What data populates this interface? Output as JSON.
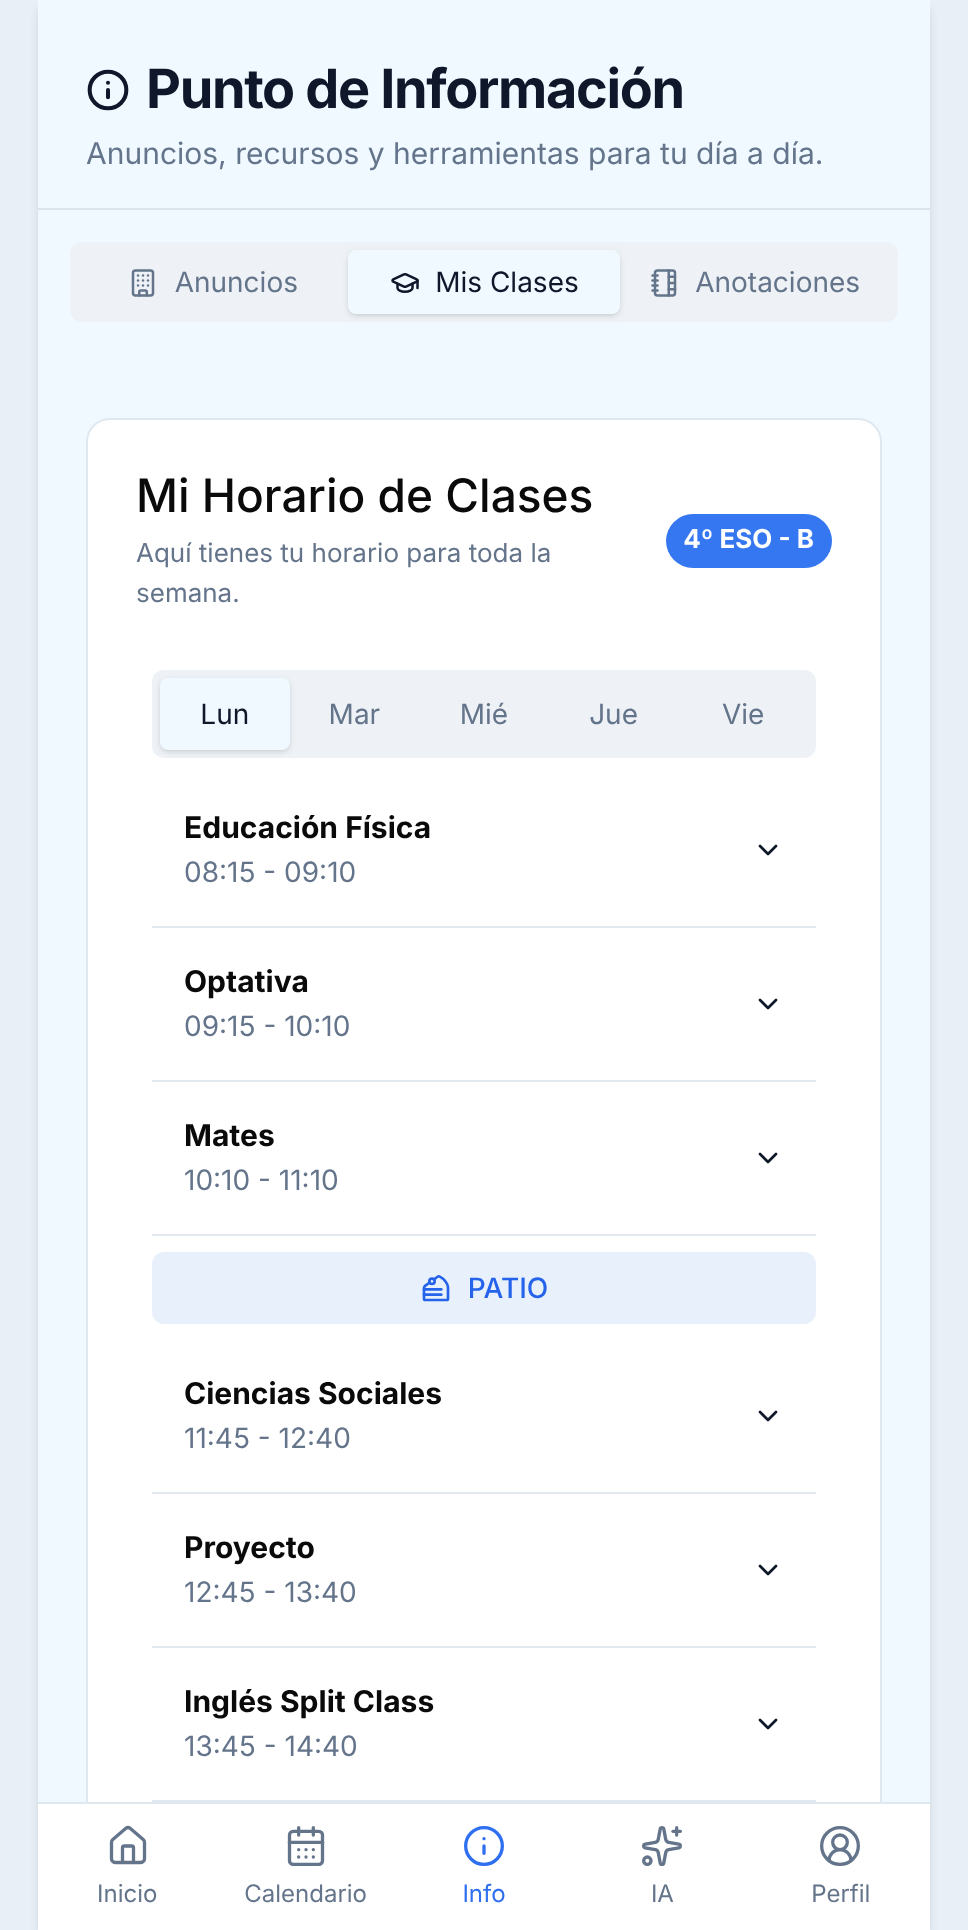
{
  "header": {
    "title": "Punto de Información",
    "subtitle": "Anuncios, recursos y herramientas para tu día a día."
  },
  "tabs": [
    {
      "label": "Anuncios",
      "selected": false
    },
    {
      "label": "Mis Clases",
      "selected": true
    },
    {
      "label": "Anotaciones",
      "selected": false
    }
  ],
  "schedule": {
    "title": "Mi Horario de Clases",
    "subtitle": "Aquí tienes tu horario para toda la semana.",
    "group_badge": "4º ESO - B",
    "days": [
      {
        "label": "Lun",
        "selected": true
      },
      {
        "label": "Mar",
        "selected": false
      },
      {
        "label": "Mié",
        "selected": false
      },
      {
        "label": "Jue",
        "selected": false
      },
      {
        "label": "Vie",
        "selected": false
      }
    ],
    "items": [
      {
        "kind": "class",
        "subject": "Educación Física",
        "time": "08:15 - 09:10",
        "expanded": false
      },
      {
        "kind": "class",
        "subject": "Optativa",
        "time": "09:15 - 10:10",
        "expanded": false
      },
      {
        "kind": "class",
        "subject": "Mates",
        "time": "10:10 - 11:10",
        "expanded": false
      },
      {
        "kind": "break",
        "label": "PATIO"
      },
      {
        "kind": "class",
        "subject": "Ciencias Sociales",
        "time": "11:45 - 12:40",
        "expanded": false
      },
      {
        "kind": "class",
        "subject": "Proyecto",
        "time": "12:45 - 13:40",
        "expanded": false
      },
      {
        "kind": "class",
        "subject": "Inglés Split Class",
        "time": "13:45 - 14:40",
        "expanded": false
      }
    ]
  },
  "bottom_nav": [
    {
      "label": "Inicio",
      "selected": false
    },
    {
      "label": "Calendario",
      "selected": false
    },
    {
      "label": "Info",
      "selected": true
    },
    {
      "label": "IA",
      "selected": false
    },
    {
      "label": "Perfil",
      "selected": false
    }
  ]
}
